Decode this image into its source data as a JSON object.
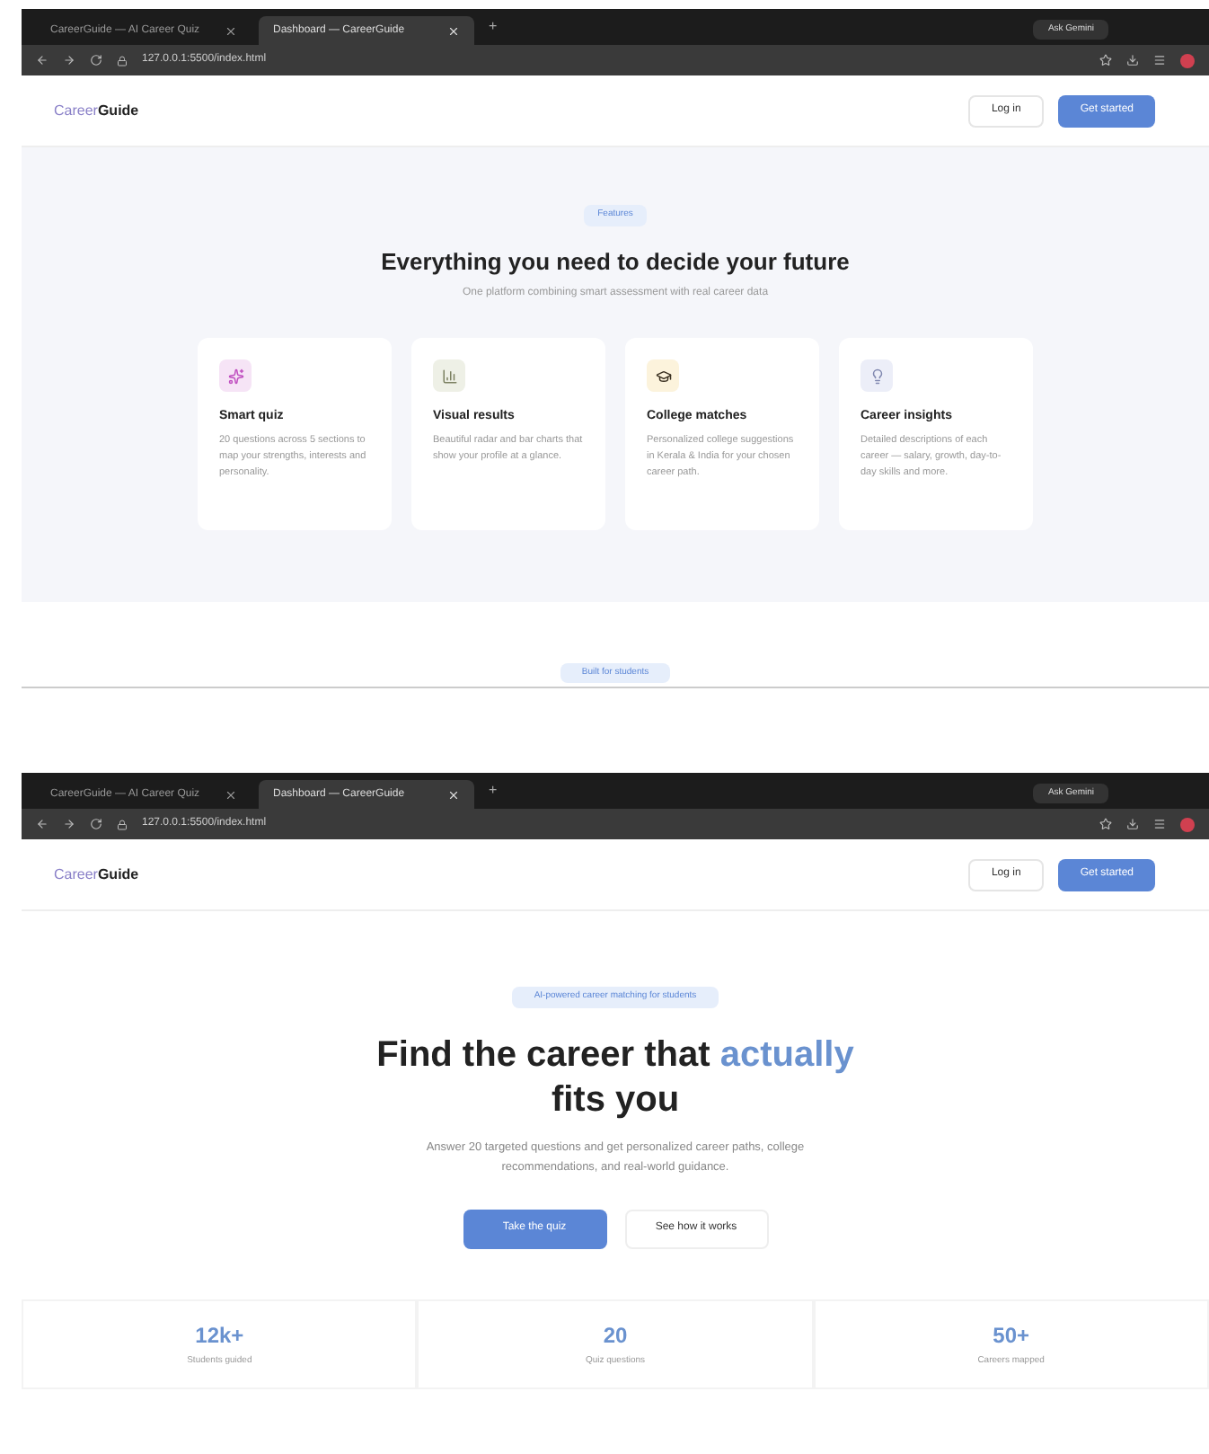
{
  "screens": [
    {
      "browser": {
        "tabs": [
          {
            "title": "CareerGuide — AI Career Quiz",
            "selected": false
          },
          {
            "title": "Dashboard — CareerGuide",
            "selected": true
          }
        ],
        "new_tab": "+",
        "url": "127.0.0.1:5500/index.html",
        "profile_button": "Ask Gemini"
      },
      "nav": {
        "logo": {
          "first": "Career",
          "second": "Guide"
        },
        "login": "Log in",
        "cta": "Get started"
      },
      "features": {
        "badge": "Features",
        "title": "Everything you need to decide your future",
        "subtitle": "One platform combining smart assessment with real career data",
        "cards": [
          {
            "kind": "quiz",
            "color": "#f6e4f6",
            "title": "Smart quiz",
            "text": "20 questions across 5 sections to map your strengths, interests and personality."
          },
          {
            "kind": "results",
            "color": "#eef0e6",
            "title": "Visual results",
            "text": "Beautiful radar and bar charts that show your profile at a glance."
          },
          {
            "kind": "college",
            "color": "#fcf3dc",
            "title": "College matches",
            "text": "Personalized college suggestions in Kerala & India for your chosen career path."
          },
          {
            "kind": "insights",
            "color": "#eceef8",
            "title": "Career insights",
            "text": "Detailed descriptions of each career — salary, growth, day-to-day skills and more."
          }
        ]
      },
      "next_badge": "Built for students"
    },
    {
      "browser": {
        "tabs": [
          {
            "title": "CareerGuide — AI Career Quiz",
            "selected": false
          },
          {
            "title": "Dashboard — CareerGuide",
            "selected": true
          }
        ],
        "new_tab": "+",
        "url": "127.0.0.1:5500/index.html",
        "profile_button": "Ask Gemini"
      },
      "nav": {
        "logo": {
          "first": "Career",
          "second": "Guide"
        },
        "login": "Log in",
        "cta": "Get started"
      },
      "hero": {
        "badge": "AI-powered career matching for students",
        "title_before": "Find the career that ",
        "title_highlight": "actually",
        "title_after": " fits you",
        "text": "Answer 20 targeted questions and get personalized career paths, college recommendations, and real-world guidance.",
        "primary": "Take the quiz",
        "secondary": "See how it works",
        "stats": [
          {
            "value": "12k+",
            "label": "Students guided"
          },
          {
            "value": "20",
            "label": "Quiz questions"
          },
          {
            "value": "50+",
            "label": "Careers mapped"
          }
        ]
      }
    }
  ]
}
